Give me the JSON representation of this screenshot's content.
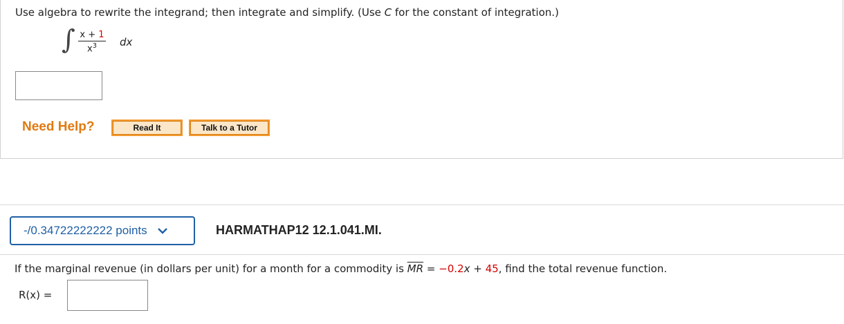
{
  "question1": {
    "prompt_parts": [
      "Use algebra to rewrite the integrand; then integrate and simplify. (Use ",
      "C",
      " for the constant of integration.)"
    ],
    "integrand": {
      "numerator_var": "x + ",
      "numerator_const": "1",
      "denominator_base": "x",
      "denominator_exp": "3",
      "differential": "dx"
    },
    "answer_value": ""
  },
  "help": {
    "label": "Need Help?",
    "read_it": "Read It",
    "talk_to_tutor": "Talk to a Tutor"
  },
  "question2": {
    "points_label": "-/0.34722222222 points",
    "question_id": "HARMATHAP12 12.1.041.MI.",
    "prompt_before": "If the marginal revenue (in dollars per unit) for a month for a commodity is ",
    "mr_label": "MR",
    "equals": " = ",
    "coef": "−0.2",
    "var": "x",
    "plus": " + ",
    "const": "45",
    "prompt_after": ",  find the total revenue function.",
    "answer_label": "R(x)  =",
    "answer_value": ""
  },
  "colors": {
    "accent_blue": "#1f5fa5",
    "help_orange": "#e07a10",
    "emphasis_red": "#d40000"
  }
}
